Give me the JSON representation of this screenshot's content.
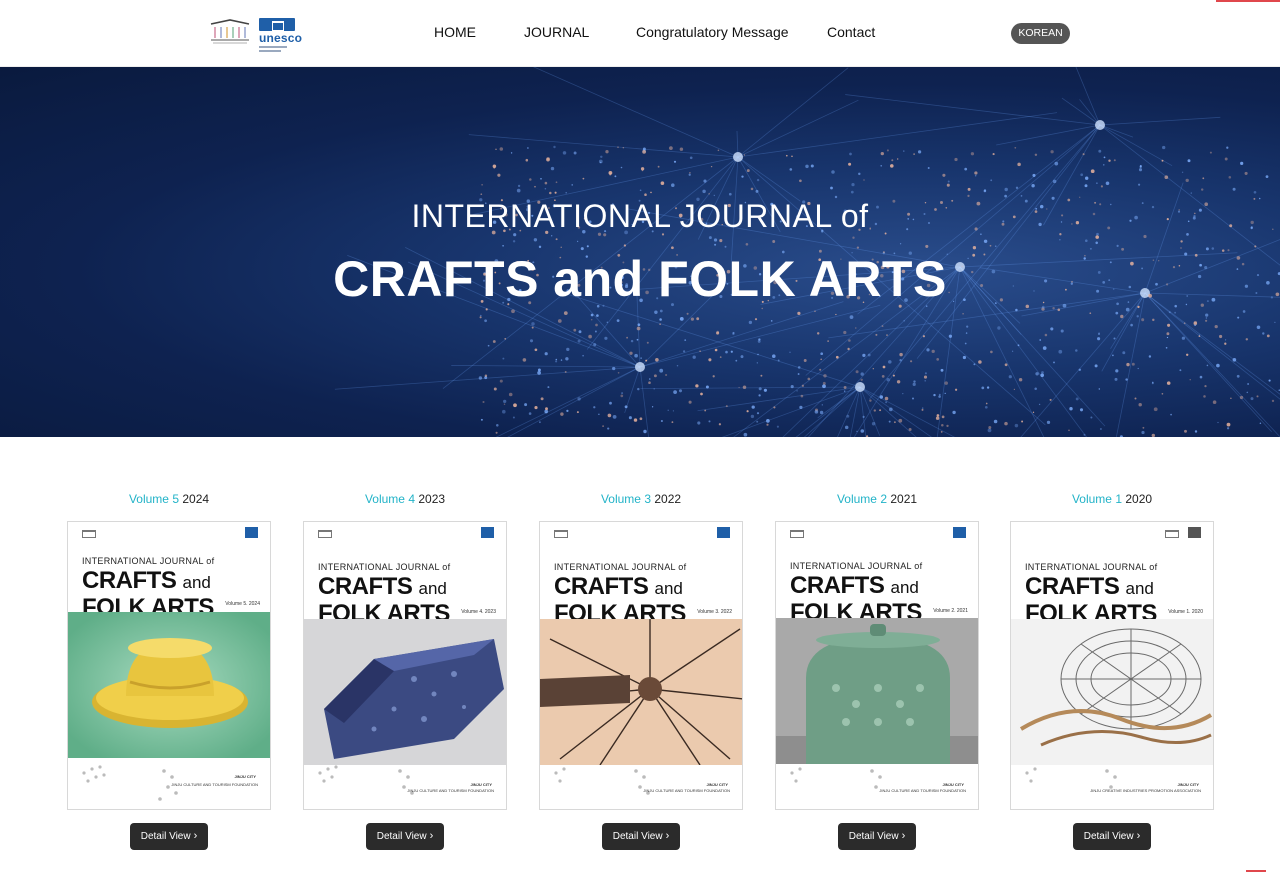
{
  "header": {
    "logo_alt": "unesco",
    "nav": [
      "HOME",
      "JOURNAL",
      "Congratulatory Message",
      "Contact"
    ],
    "language_button": "KOREAN"
  },
  "hero": {
    "title_line1": "INTERNATIONAL JOURNAL of",
    "title_line2": "CRAFTS and FOLK ARTS"
  },
  "volumes": [
    {
      "volume": "Volume 5",
      "year": "2024",
      "button": "Detail View",
      "cover_small": "INTERNATIONAL JOURNAL of",
      "cover_big1": "CRAFTS",
      "cover_and": "and",
      "cover_big2": "FOLK ARTS",
      "cover_vol": "Volume 5. 2024",
      "cover_pub1": "JINJU CITY",
      "cover_pub2": "JINJU CULTURE AND TOURISM FOUNDATION"
    },
    {
      "volume": "Volume 4",
      "year": "2023",
      "button": "Detail View",
      "cover_small": "INTERNATIONAL JOURNAL of",
      "cover_big1": "CRAFTS",
      "cover_and": "and",
      "cover_big2": "FOLK ARTS",
      "cover_vol": "Volume 4. 2023",
      "cover_pub1": "JINJU CITY",
      "cover_pub2": "JINJU CULTURE AND TOURISM FOUNDATION"
    },
    {
      "volume": "Volume 3",
      "year": "2022",
      "button": "Detail View",
      "cover_small": "INTERNATIONAL JOURNAL of",
      "cover_big1": "CRAFTS",
      "cover_and": "and",
      "cover_big2": "FOLK ARTS",
      "cover_vol": "Volume 3. 2022",
      "cover_pub1": "JINJU CITY",
      "cover_pub2": "JINJU CULTURE AND TOURISM FOUNDATION"
    },
    {
      "volume": "Volume 2",
      "year": "2021",
      "button": "Detail View",
      "cover_small": "INTERNATIONAL JOURNAL of",
      "cover_big1": "CRAFTS",
      "cover_and": "and",
      "cover_big2": "FOLK ARTS",
      "cover_vol": "Volume 2. 2021",
      "cover_pub1": "JINJU CITY",
      "cover_pub2": "JINJU CULTURE AND TOURISM FOUNDATION"
    },
    {
      "volume": "Volume 1",
      "year": "2020",
      "button": "Detail View",
      "cover_small": "INTERNATIONAL JOURNAL of",
      "cover_big1": "CRAFTS",
      "cover_and": "and",
      "cover_big2": "FOLK ARTS",
      "cover_vol": "Volume 1. 2020",
      "cover_pub1": "JINJU CITY",
      "cover_pub2": "JINJU CREATIVE INDUSTRIES PROMOTION ASSOCIATION"
    }
  ],
  "colors": {
    "accent": "#22b3c8",
    "button_bg": "#2b2b2b",
    "hero_bg": "#0e2250",
    "unesco_blue": "#1f5fa8"
  },
  "icons": [
    "city-logo-icon",
    "unesco-logo-icon",
    "chevron-right-icon"
  ]
}
